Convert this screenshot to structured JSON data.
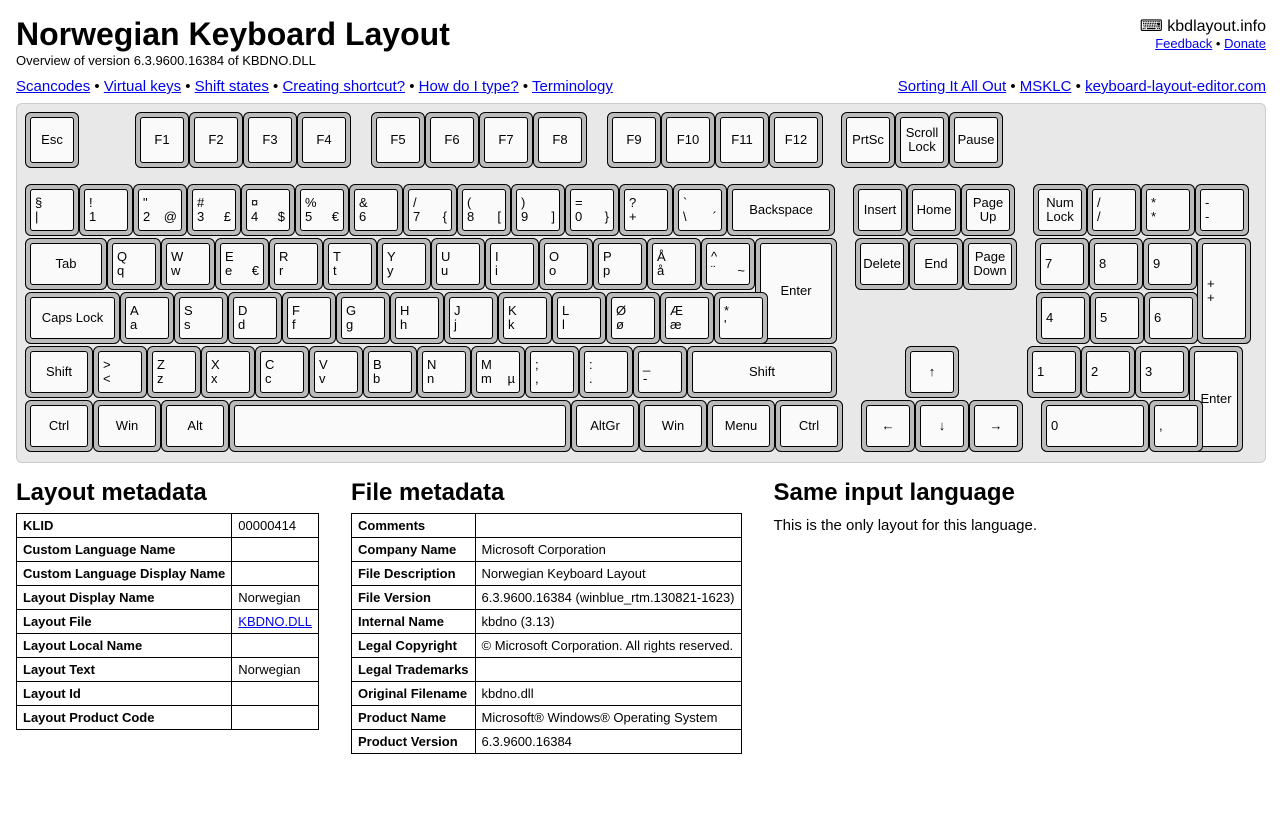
{
  "header": {
    "title": "Norwegian Keyboard Layout",
    "subtitle": "Overview of version 6.3.9600.16384 of KBDNO.DLL",
    "brand_icon": "⌨",
    "brand_text": "kbdlayout.info",
    "feedback": "Feedback",
    "donate": "Donate"
  },
  "nav_left": [
    "Scancodes",
    "Virtual keys",
    "Shift states",
    "Creating shortcut?",
    "How do I type?",
    "Terminology"
  ],
  "nav_right": [
    "Sorting It All Out",
    "MSKLC",
    "keyboard-layout-editor.com"
  ],
  "keys": {
    "esc": "Esc",
    "f": [
      "F1",
      "F2",
      "F3",
      "F4",
      "F5",
      "F6",
      "F7",
      "F8",
      "F9",
      "F10",
      "F11",
      "F12"
    ],
    "sys": [
      "PrtSc",
      "Scroll Lock",
      "Pause"
    ],
    "row1": [
      {
        "t": "§",
        "b": "|"
      },
      {
        "t": "!",
        "b": "1"
      },
      {
        "t": "\"",
        "b": "2",
        "br": "@"
      },
      {
        "t": "#",
        "b": "3",
        "br": "£"
      },
      {
        "t": "¤",
        "b": "4",
        "br": "$"
      },
      {
        "t": "%",
        "b": "5",
        "br": "€"
      },
      {
        "t": "&",
        "b": "6"
      },
      {
        "t": "/",
        "b": "7",
        "br": "{"
      },
      {
        "t": "(",
        "b": "8",
        "br": "["
      },
      {
        "t": ")",
        "b": "9",
        "br": "]"
      },
      {
        "t": "=",
        "b": "0",
        "br": "}"
      },
      {
        "t": "?",
        "b": "+"
      },
      {
        "t": "`",
        "b": "\\",
        "br": "´"
      }
    ],
    "backspace": "Backspace",
    "nav1": [
      "Insert",
      "Home",
      "Page Up"
    ],
    "nav2": [
      "Delete",
      "End",
      "Page Down"
    ],
    "numtop": [
      "Num Lock",
      "/\n/",
      "*\n*",
      "-\n-"
    ],
    "tab": "Tab",
    "row2": [
      {
        "t": "Q",
        "b": "q"
      },
      {
        "t": "W",
        "b": "w"
      },
      {
        "t": "E",
        "b": "e",
        "br": "€"
      },
      {
        "t": "R",
        "b": "r"
      },
      {
        "t": "T",
        "b": "t"
      },
      {
        "t": "Y",
        "b": "y"
      },
      {
        "t": "U",
        "b": "u"
      },
      {
        "t": "I",
        "b": "i"
      },
      {
        "t": "O",
        "b": "o"
      },
      {
        "t": "P",
        "b": "p"
      },
      {
        "t": "Å",
        "b": "å"
      },
      {
        "t": "^",
        "b": "¨",
        "br": "~"
      }
    ],
    "enter": "Enter",
    "num789": [
      "7",
      "8",
      "9"
    ],
    "numplus": {
      "t": "+",
      "b": "+"
    },
    "caps": "Caps Lock",
    "row3": [
      {
        "t": "A",
        "b": "a"
      },
      {
        "t": "S",
        "b": "s"
      },
      {
        "t": "D",
        "b": "d"
      },
      {
        "t": "F",
        "b": "f"
      },
      {
        "t": "G",
        "b": "g"
      },
      {
        "t": "H",
        "b": "h"
      },
      {
        "t": "J",
        "b": "j"
      },
      {
        "t": "K",
        "b": "k"
      },
      {
        "t": "L",
        "b": "l"
      },
      {
        "t": "Ø",
        "b": "ø"
      },
      {
        "t": "Æ",
        "b": "æ"
      },
      {
        "t": "*",
        "b": "'"
      }
    ],
    "num456": [
      "4",
      "5",
      "6"
    ],
    "lshift": "Shift",
    "iso": {
      "t": ">",
      "b": "<"
    },
    "row4": [
      {
        "t": "Z",
        "b": "z"
      },
      {
        "t": "X",
        "b": "x"
      },
      {
        "t": "C",
        "b": "c"
      },
      {
        "t": "V",
        "b": "v"
      },
      {
        "t": "B",
        "b": "b"
      },
      {
        "t": "N",
        "b": "n"
      },
      {
        "t": "M",
        "b": "m",
        "br": "µ"
      },
      {
        "t": ";",
        "b": ","
      },
      {
        "t": ":",
        "b": "."
      },
      {
        "t": "_",
        "b": "-"
      }
    ],
    "rshift": "Shift",
    "up": "↑",
    "num123": [
      "1",
      "2",
      "3"
    ],
    "numenter": "Enter",
    "bottom": [
      "Ctrl",
      "Win",
      "Alt"
    ],
    "bottom_r": [
      "AltGr",
      "Win",
      "Menu",
      "Ctrl"
    ],
    "arrows": [
      "←",
      "↓",
      "→"
    ],
    "num0": "0",
    "numdot": ","
  },
  "layout_meta": {
    "heading": "Layout metadata",
    "rows": [
      [
        "KLID",
        "00000414"
      ],
      [
        "Custom Language Name",
        ""
      ],
      [
        "Custom Language Display Name",
        ""
      ],
      [
        "Layout Display Name",
        "Norwegian"
      ],
      [
        "Layout File",
        "KBDNO.DLL"
      ],
      [
        "Layout Local Name",
        ""
      ],
      [
        "Layout Text",
        "Norwegian"
      ],
      [
        "Layout Id",
        ""
      ],
      [
        "Layout Product Code",
        ""
      ]
    ]
  },
  "file_meta": {
    "heading": "File metadata",
    "rows": [
      [
        "Comments",
        ""
      ],
      [
        "Company Name",
        "Microsoft Corporation"
      ],
      [
        "File Description",
        "Norwegian Keyboard Layout"
      ],
      [
        "File Version",
        "6.3.9600.16384 (winblue_rtm.130821-1623)"
      ],
      [
        "Internal Name",
        "kbdno (3.13)"
      ],
      [
        "Legal Copyright",
        "© Microsoft Corporation. All rights reserved."
      ],
      [
        "Legal Trademarks",
        ""
      ],
      [
        "Original Filename",
        "kbdno.dll"
      ],
      [
        "Product Name",
        "Microsoft® Windows® Operating System"
      ],
      [
        "Product Version",
        "6.3.9600.16384"
      ]
    ]
  },
  "same_lang": {
    "heading": "Same input language",
    "text": "This is the only layout for this language."
  }
}
